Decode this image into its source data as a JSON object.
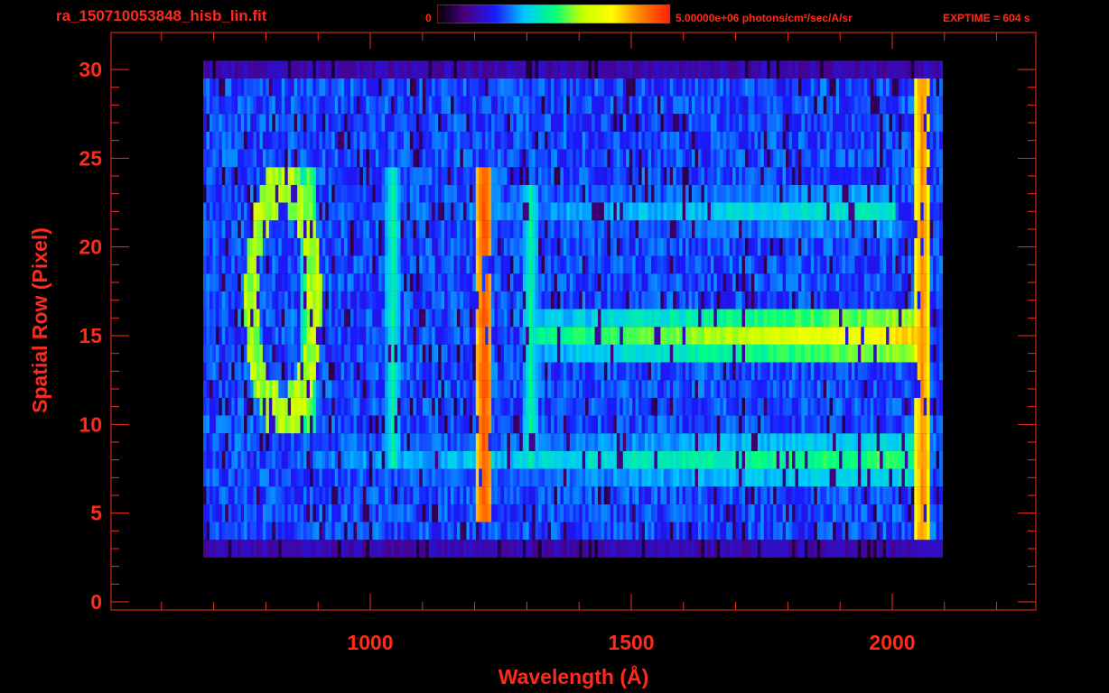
{
  "header": {
    "filename": "ra_150710053848_hisb_lin.fit",
    "colorbar_min": "0",
    "colorbar_max": "5.00000e+06 photons/cm²/sec/A/sr",
    "exptime": "EXPTIME = 604 s"
  },
  "colors": {
    "axis": "#ff2a1a",
    "background": "#000000",
    "colormap": [
      "#000000",
      "#4b0082",
      "#1a1aff",
      "#00c8ff",
      "#00ff7f",
      "#c8ff00",
      "#ffff00",
      "#ff8000",
      "#ff2000"
    ]
  },
  "chart_data": {
    "type": "heatmap",
    "xlabel": "Wavelength (Å)",
    "ylabel": "Spatial Row (Pixel)",
    "x_ticks": [
      1000,
      1500,
      2000
    ],
    "y_ticks": [
      0,
      5,
      10,
      15,
      20,
      25,
      30
    ],
    "xlim": [
      510,
      2250
    ],
    "ylim": [
      -0.5,
      30.5
    ],
    "colorbar_range": [
      0,
      5000000
    ],
    "colorbar_unit": "photons/cm²/sec/A/sr",
    "features": [
      {
        "wavelength": 1216,
        "rows": [
          5,
          24
        ],
        "level": 0.92
      },
      {
        "wavelength": 2055,
        "rows": [
          4,
          29
        ],
        "level": 0.85
      },
      {
        "wavelength": 1040,
        "rows": [
          8,
          24
        ],
        "level": 0.45
      },
      {
        "wavelength": 1304,
        "rows": [
          8,
          23
        ],
        "level": 0.45
      },
      {
        "wavelength": 880,
        "rows": [
          10,
          24
        ],
        "level": 0.55
      }
    ],
    "bands": [
      {
        "row_center": 15,
        "wavelength_range": [
          1300,
          2060
        ],
        "level": 0.75
      },
      {
        "row_center": 8,
        "wavelength_range": [
          900,
          2060
        ],
        "level": 0.5
      },
      {
        "row_center": 22,
        "wavelength_range": [
          850,
          2000
        ],
        "level": 0.4
      }
    ],
    "data_extent": {
      "wavelength": [
        680,
        2095
      ],
      "rows": [
        3,
        30
      ]
    }
  }
}
